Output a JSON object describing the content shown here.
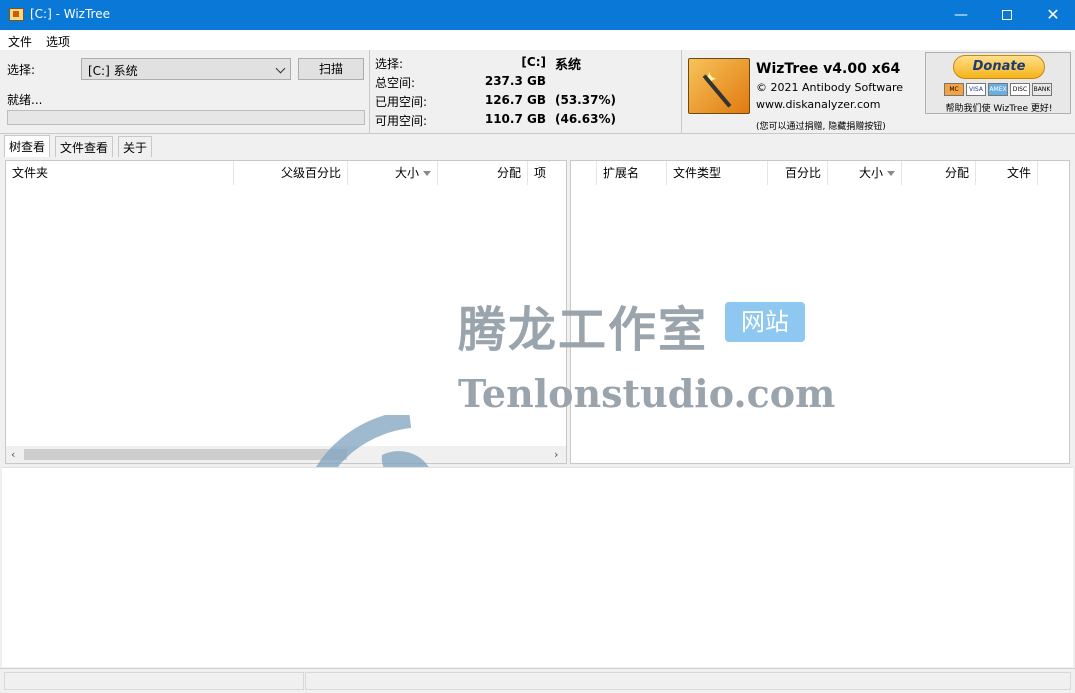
{
  "window": {
    "title": "[C:]  - WizTree"
  },
  "menu": {
    "file": "文件",
    "options": "选项"
  },
  "scan": {
    "select_label": "选择:",
    "drive_value": "[C:] 系统",
    "scan_button": "扫描",
    "status": "就绪..."
  },
  "info": {
    "select_label": "选择:",
    "drive": "[C:]",
    "drive_name": "系统",
    "total_label": "总空间:",
    "total_value": "237.3 GB",
    "used_label": "已用空间:",
    "used_value": "126.7 GB",
    "used_pct": "(53.37%)",
    "free_label": "可用空间:",
    "free_value": "110.7 GB",
    "free_pct": "(46.63%)"
  },
  "about": {
    "product": "WizTree v4.00 x64",
    "copyright": "© 2021 Antibody Software",
    "website": "www.diskanalyzer.com",
    "note": "(您可以通过捐赠, 隐藏捐赠按钮)"
  },
  "donate": {
    "button": "Donate",
    "cards": [
      "MC",
      "VISA",
      "AMEX",
      "DISC",
      "BANK"
    ],
    "caption": "帮助我们使 WizTree 更好!"
  },
  "tabs": [
    "树查看",
    "文件查看",
    "关于"
  ],
  "tree_columns": [
    "文件夹",
    "父级百分比",
    "大小",
    "分配",
    "项"
  ],
  "ext_columns": [
    "扩展名",
    "文件类型",
    "百分比",
    "大小",
    "分配",
    "文件"
  ],
  "watermark": {
    "cn": "腾龙工作室",
    "badge": "网站",
    "en": "Tenlonstudio.com"
  },
  "colors": {
    "titlebar": "#0a78d7",
    "accent": "#f6b21a"
  }
}
